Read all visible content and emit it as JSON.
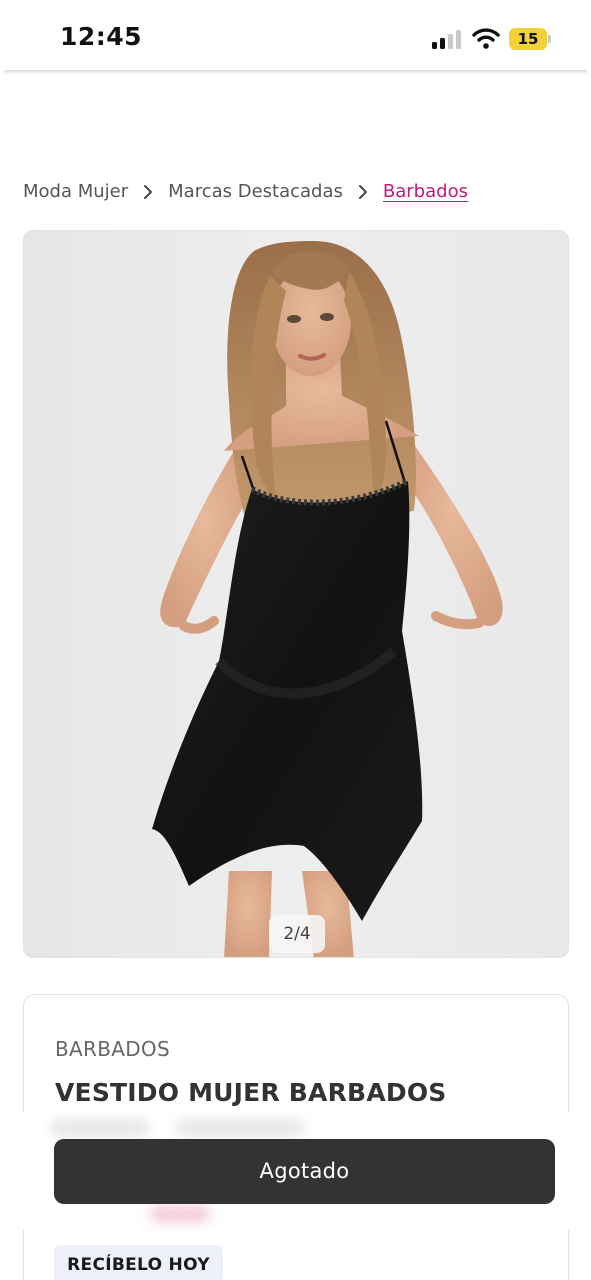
{
  "status_bar": {
    "time": "12:45",
    "battery_level": "15",
    "icons": [
      "cellular-signal-icon",
      "wifi-icon",
      "battery-icon"
    ],
    "battery_color": "#f2d23a"
  },
  "breadcrumb": {
    "items": [
      {
        "label": "Moda Mujer"
      },
      {
        "label": "Marcas Destacadas"
      },
      {
        "label": "Barbados"
      }
    ],
    "separator_icon": "chevron-right-icon",
    "active_color": "#c2187a"
  },
  "gallery": {
    "image_description_icon": "product-photo",
    "counter": "2/4",
    "current_image": 2,
    "total_images": 4
  },
  "product": {
    "brand": "BARBADOS",
    "title": "VESTIDO MUJER BARBADOS"
  },
  "purchase": {
    "button_label": "Agotado",
    "button_color": "#333333"
  },
  "delivery": {
    "badge_label": "RECÍBELO HOY",
    "badge_color": "#edf0fb"
  }
}
